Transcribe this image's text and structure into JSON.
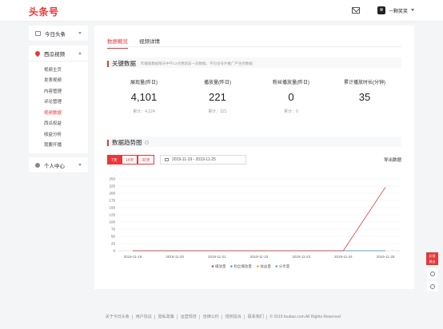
{
  "header": {
    "logo": "头条号",
    "username": "一颗笑笑",
    "icons": [
      "mail-icon",
      "avatar"
    ]
  },
  "sidebar": {
    "groups": [
      {
        "label": "今日头条",
        "icon": "document-icon",
        "expanded": false
      },
      {
        "label": "西瓜视频",
        "icon": "xigua-icon",
        "expanded": true,
        "items": [
          {
            "label": "视频主页"
          },
          {
            "label": "发表视频"
          },
          {
            "label": "内容管理"
          },
          {
            "label": "评论管理"
          },
          {
            "label": "视频数据",
            "active": true
          },
          {
            "label": "西瓜权益"
          },
          {
            "label": "收益分析"
          },
          {
            "label": "我要开播"
          }
        ]
      },
      {
        "label": "个人中心",
        "icon": "user-icon",
        "expanded": false
      }
    ]
  },
  "main": {
    "tabs": [
      {
        "label": "数据概览",
        "active": true
      },
      {
        "label": "视频详情",
        "active": false
      }
    ],
    "key_data": {
      "title": "关键数据",
      "note": "昨缓缆数据每天中午12点更新前一日数据，不包含号外推广产生的数据",
      "stats": [
        {
          "label": "展现量(昨日)",
          "value": "4,101",
          "total": "累计：4,124"
        },
        {
          "label": "播放量(昨日)",
          "value": "221",
          "total": "累计：221"
        },
        {
          "label": "粉丝播放量(昨日)",
          "value": "0",
          "total": "累计：0"
        },
        {
          "label": "累计播放时长(分钟)",
          "value": "35",
          "total": ""
        }
      ]
    },
    "trend": {
      "title": "数据趋势图",
      "ranges": [
        {
          "label": "7天",
          "active": true
        },
        {
          "label": "14天",
          "active": false
        },
        {
          "label": "30天",
          "active": false
        }
      ],
      "date_range": "2019-11-19 - 2019-11-25",
      "export_label": "导出数据"
    }
  },
  "chart_data": {
    "type": "line",
    "x": [
      "2019-11-19",
      "2019-11-20",
      "2019-11-21",
      "2019-11-22",
      "2019-11-23",
      "2019-11-24",
      "2019-11-25"
    ],
    "yticks": [
      0,
      25,
      50,
      75,
      100,
      125,
      150,
      175,
      200,
      225,
      250
    ],
    "ylim": [
      0,
      250
    ],
    "series": [
      {
        "name": "播放量",
        "color": "#e8373a",
        "values": [
          0,
          0,
          0,
          0,
          0,
          0,
          221
        ]
      },
      {
        "name": "粉丝播放量",
        "color": "#3aa0e8",
        "values": [
          0,
          0,
          0,
          0,
          0,
          0,
          0
        ]
      },
      {
        "name": "收益量",
        "color": "#f5a623",
        "values": [
          0,
          0,
          0,
          0,
          0,
          0,
          0
        ]
      },
      {
        "name": "分享量",
        "color": "#46b8a0",
        "values": [
          0,
          0,
          0,
          0,
          0,
          0,
          0
        ]
      }
    ],
    "grid": true,
    "legend": "bottom-center"
  },
  "float": {
    "feedback_line1": "反馈",
    "feedback_line2": "建议"
  },
  "footer": {
    "links": [
      "关于今日头条",
      "用户协议",
      "隐私政策",
      "运营规范",
      "自律公约",
      "侵权投诉",
      "联系我们"
    ],
    "copyright": "© 2019 toutiao.com All Rights Reserved"
  }
}
